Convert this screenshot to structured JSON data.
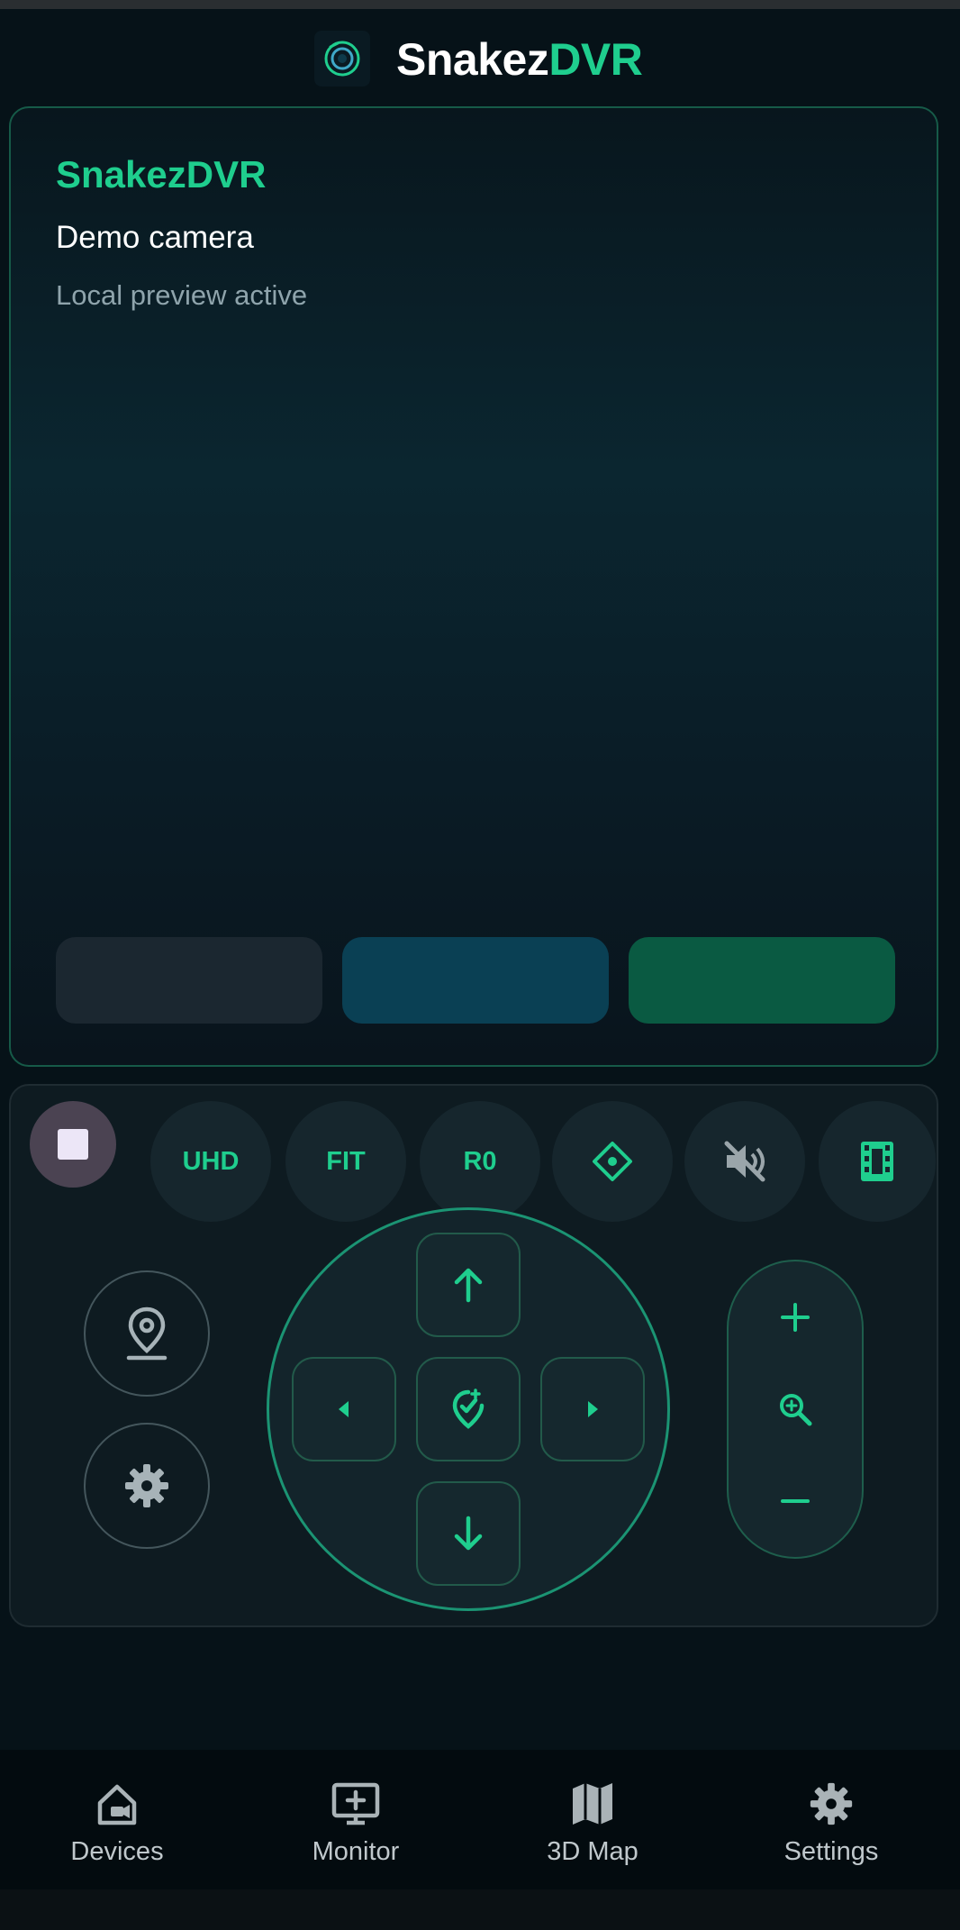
{
  "app": {
    "brand_part1": "Snakez",
    "brand_part2": "DVR",
    "logo_icon": "camera-lens-icon"
  },
  "preview": {
    "title": "SnakezDVR",
    "camera_name": "Demo camera",
    "status": "Local preview active",
    "buttons": [
      {
        "label": "",
        "color": "#1b2730"
      },
      {
        "label": "",
        "color": "#0a4054"
      },
      {
        "label": "",
        "color": "#0a5a42"
      }
    ]
  },
  "toolbar": {
    "stop_icon": "stop-icon",
    "quality_label": "UHD",
    "fit_label": "FIT",
    "rotation_label": "R0",
    "ptz_icon": "ptz-center-icon",
    "mute_icon": "volume-off-icon",
    "record_icon": "film-icon"
  },
  "ptz": {
    "location_icon": "map-pin-icon",
    "settings_icon": "gear-icon",
    "up_icon": "arrow-up-icon",
    "down_icon": "arrow-down-icon",
    "left_icon": "caret-left-icon",
    "right_icon": "caret-right-icon",
    "center_icon": "location-target-icon",
    "zoom_in_icon": "plus-icon",
    "zoom_icon": "zoom-icon",
    "zoom_out_icon": "minus-icon"
  },
  "nav": {
    "items": [
      {
        "label": "Devices",
        "icon": "home-camera-icon"
      },
      {
        "label": "Monitor",
        "icon": "monitor-add-icon"
      },
      {
        "label": "3D Map",
        "icon": "map-icon"
      },
      {
        "label": "Settings",
        "icon": "gear-icon"
      }
    ]
  },
  "colors": {
    "accent": "#1fce8e",
    "background": "#061218",
    "panel_border": "#165a48"
  }
}
